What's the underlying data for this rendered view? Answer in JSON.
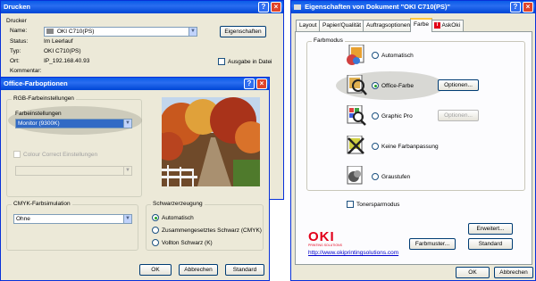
{
  "print_dialog": {
    "title": "Drucken",
    "group_label": "Drucker",
    "name_label": "Name:",
    "printer_name": "OKI C710(PS)",
    "status_label": "Status:",
    "status_value": "Im Leerlauf",
    "type_label": "Typ:",
    "type_value": "OKI C710(PS)",
    "location_label": "Ort:",
    "location_value": "IP_192.168.40.93",
    "comment_label": "Kommentar:",
    "properties_button": "Eigenschaften",
    "print_to_file_label": "Ausgabe in Datei"
  },
  "office_colors": {
    "title": "Office-Farboptionen",
    "rgb_group": "RGB-Farbeinstellungen",
    "color_settings_label": "Farbeinstellungen",
    "color_settings_value": "Monitor (9300K)",
    "color_correct_label": "Colour Correct Einstellungen",
    "cmyk_group": "CMYK-Farbsimulation",
    "cmyk_value": "Ohne",
    "black_group": "Schwarzerzeugung",
    "black_options": [
      "Automatisch",
      "Zusammengesetztes Schwarz (CMYK)",
      "Vollton Schwarz (K)"
    ],
    "ok_button": "OK",
    "cancel_button": "Abbrechen",
    "standard_button": "Standard"
  },
  "doc_props": {
    "title": "Eigenschaften von Dokument \"OKI C710(PS)\"",
    "tabs": [
      "Layout",
      "Papier/Qualität",
      "Auftragsoptionen",
      "Farbe",
      "AskOki"
    ],
    "color_mode_group": "Farbmodus",
    "modes": [
      "Automatisch",
      "Office-Farbe",
      "Graphic Pro",
      "Keine Farbanpassung",
      "Graustufen"
    ],
    "options_button": "Optionen...",
    "options_button_2": "Optionen...",
    "toner_save_label": "Tonersparmodus",
    "advanced_button": "Erweitert...",
    "color_sample_button": "Farbmuster...",
    "standard_button": "Standard",
    "logo_text": "OKI",
    "logo_subtext": "PRINTING SOLUTIONS",
    "url": "http://www.okiprintingsolutions.com",
    "ok_button": "OK",
    "cancel_button": "Abbrechen"
  },
  "colors": {
    "title_blue": "#0a5ce8",
    "oki_red": "#e2001a",
    "selection_blue": "#316ac5"
  }
}
